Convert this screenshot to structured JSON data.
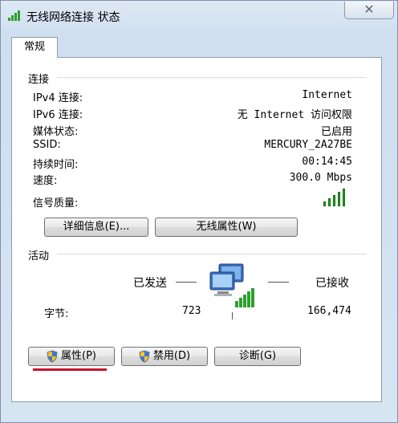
{
  "window": {
    "title": "无线网络连接 状态"
  },
  "tabs": [
    {
      "label": "常规"
    }
  ],
  "connection": {
    "group_label": "连接",
    "rows": [
      {
        "label": "IPv4 连接:",
        "value": "Internet"
      },
      {
        "label": "IPv6 连接:",
        "value": "无 Internet 访问权限"
      },
      {
        "label": "媒体状态:",
        "value": "已启用"
      },
      {
        "label": "SSID:",
        "value": "MERCURY_2A27BE"
      },
      {
        "label": "持续时间:",
        "value": "00:14:45"
      },
      {
        "label": "速度:",
        "value": "300.0 Mbps"
      }
    ],
    "signal_label": "信号质量:",
    "signal_bars_lit": 5,
    "details_button": "详细信息(E)...",
    "wireless_props_button": "无线属性(W)"
  },
  "activity": {
    "group_label": "活动",
    "sent_label": "已发送",
    "received_label": "已接收",
    "bytes_label": "字节:",
    "bytes_sent": "723",
    "bytes_received": "166,474"
  },
  "buttons": {
    "properties": "属性(P)",
    "disable": "禁用(D)",
    "diagnose": "诊断(G)"
  },
  "colors": {
    "signal_green": "#2ea02e",
    "highlight_underline": "#c8102e"
  }
}
